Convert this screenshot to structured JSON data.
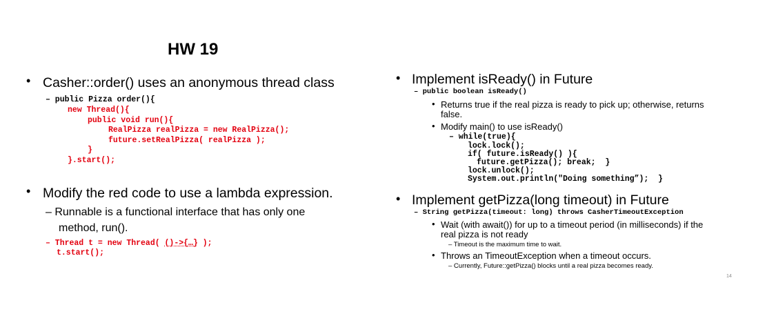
{
  "title": "HW 19",
  "left": {
    "bullet1": {
      "text": "Casher::order() uses an anonymous thread class",
      "sig": "– public Pizza order(){",
      "code_lines": [
        "new Thread(){",
        "public void run(){",
        "RealPizza realPizza = new RealPizza();",
        "future.setRealPizza( realPizza );",
        "}",
        "}.start();"
      ]
    },
    "bullet2": {
      "text": "Modify the red code to use a lambda expression.",
      "sub_line1": "– Runnable is a functional interface that has only one",
      "sub_line2": "method, run().",
      "code_pre": "– Thread t = new Thread( ",
      "code_lambda": "()->{…}",
      "code_post": " );",
      "code_line2": "t.start();"
    }
  },
  "right": {
    "bullet1": {
      "text": "Implement isReady() in Future",
      "sig": "– public boolean isReady()",
      "sub1_line1": "Returns true if the real pizza is ready to pick up; otherwise, returns",
      "sub1_line2": "false.",
      "sub2": "Modify main() to use isReady()",
      "code_lines": [
        "– while(true){",
        "lock.lock();",
        "if( future.isReady() ){",
        "future.getPizza(); break;  }",
        "lock.unlock();",
        "System.out.println(\"Doing something”);  }"
      ]
    },
    "bullet2": {
      "text": "Implement getPizza(long timeout) in Future",
      "sig": "– String getPizza(timeout: long) throws CasherTimeoutException",
      "sub1_line1": "Wait (with await()) for up to a timeout period (in milliseconds) if the",
      "sub1_line2": "real pizza is not ready",
      "sub1_note": "– Timeout is the maximum time to wait.",
      "sub2": "Throws an TimeoutException when a timeout occurs.",
      "sub2_note": "– Currently, Future::getPizza() blocks until a real pizza becomes ready."
    }
  },
  "page_number": "14"
}
